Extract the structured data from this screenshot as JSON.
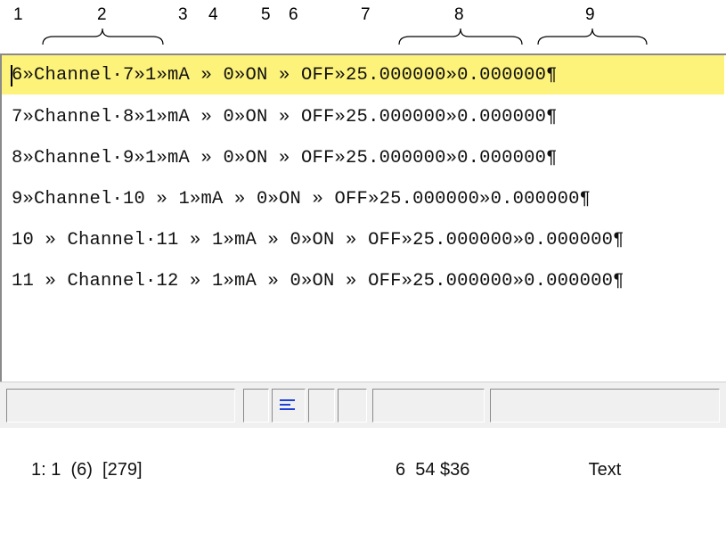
{
  "ruler": {
    "columns": [
      "1",
      "2",
      "3",
      "4",
      "5",
      "6",
      "7",
      "8",
      "9"
    ]
  },
  "editor": {
    "lines": [
      "6»Channel·7»1»mA » 0»ON » OFF»25.000000»0.000000¶",
      "7»Channel·8»1»mA » 0»ON » OFF»25.000000»0.000000¶",
      "8»Channel·9»1»mA » 0»ON » OFF»25.000000»0.000000¶",
      "9»Channel·10 » 1»mA » 0»ON » OFF»25.000000»0.000000¶",
      "10 » Channel·11 » 1»mA » 0»ON » OFF»25.000000»0.000000¶",
      "11 » Channel·12 » 1»mA » 0»ON » OFF»25.000000»0.000000¶"
    ],
    "highlight_color": "#fdf27a"
  },
  "statusbar": {
    "position": "1: 1  (6)  [279]",
    "info": "6  54 $36",
    "mode": "Text",
    "align_icon": "align-left-icon",
    "icon_color": "#1f3fd6"
  }
}
